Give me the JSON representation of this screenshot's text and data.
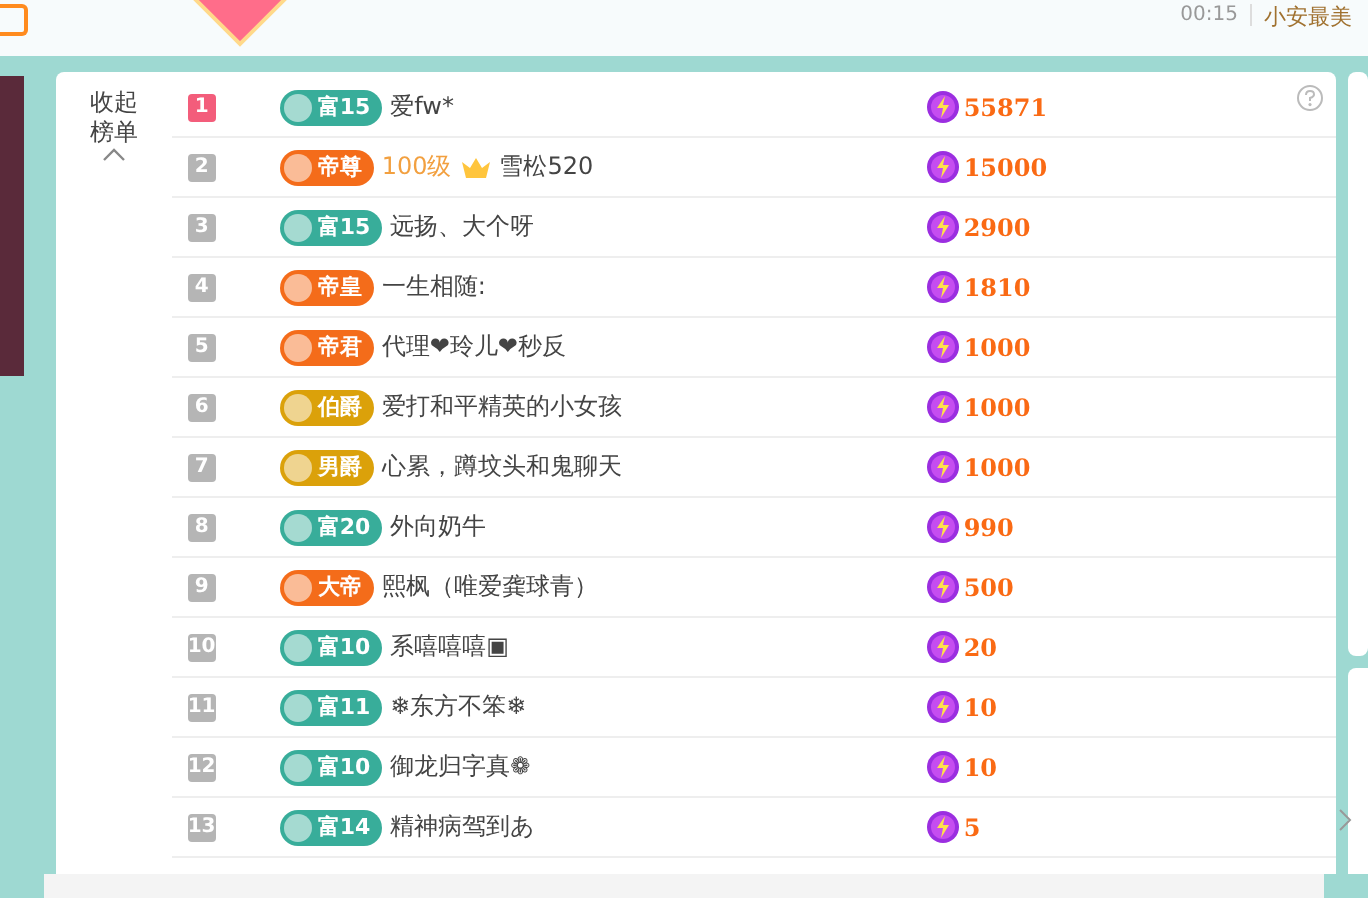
{
  "top_bar": {
    "time": "00:15",
    "user": "小安最美"
  },
  "ranking": {
    "collapse_label": "收起榜单",
    "rows": [
      {
        "rank": "1",
        "top": true,
        "kind": "fortune",
        "badge": "富15",
        "name": "爱fw*",
        "value": "55871"
      },
      {
        "rank": "2",
        "top": false,
        "kind": "emperor",
        "badge": "帝尊",
        "level_tag": "100级",
        "name": "雪松520",
        "value": "15000"
      },
      {
        "rank": "3",
        "top": false,
        "kind": "fortune",
        "badge": "富15",
        "name": "远扬、大个呀",
        "value": "2900"
      },
      {
        "rank": "4",
        "top": false,
        "kind": "emperor",
        "badge": "帝皇",
        "name": "一生相随:",
        "value": "1810"
      },
      {
        "rank": "5",
        "top": false,
        "kind": "emperor",
        "badge": "帝君",
        "name": "代理❤玲儿❤秒反",
        "value": "1000"
      },
      {
        "rank": "6",
        "top": false,
        "kind": "noble",
        "badge": "伯爵",
        "name": "爱打和平精英的小女孩",
        "value": "1000"
      },
      {
        "rank": "7",
        "top": false,
        "kind": "noble",
        "badge": "男爵",
        "name": "心累，蹲坟头和鬼聊天",
        "value": "1000"
      },
      {
        "rank": "8",
        "top": false,
        "kind": "fortune",
        "badge": "富20",
        "name": "外向奶牛",
        "value": "990"
      },
      {
        "rank": "9",
        "top": false,
        "kind": "emperor",
        "badge": "大帝",
        "name": "熙枫（唯爱龚球青）",
        "value": "500"
      },
      {
        "rank": "10",
        "top": false,
        "kind": "fortune",
        "badge": "富10",
        "name": "系嘻嘻嘻▣",
        "value": "20"
      },
      {
        "rank": "11",
        "top": false,
        "kind": "fortune",
        "badge": "富11",
        "name": "❄东方不笨❄",
        "value": "10"
      },
      {
        "rank": "12",
        "top": false,
        "kind": "fortune",
        "badge": "富10",
        "name": "御龙归字真❁",
        "value": "10"
      },
      {
        "rank": "13",
        "top": false,
        "kind": "fortune",
        "badge": "富14",
        "name": "精神病驾到あ",
        "value": "5"
      }
    ]
  }
}
